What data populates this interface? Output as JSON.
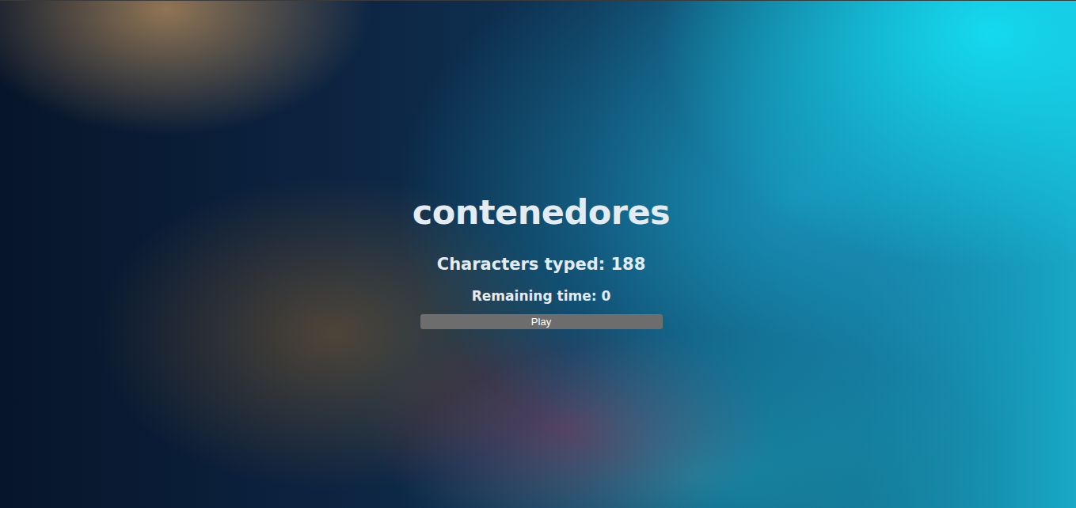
{
  "game": {
    "word": "contenedores",
    "characters_typed": "Characters typed: 188",
    "remaining_time": "Remaining time: 0",
    "play_button": {
      "label": "Play",
      "disabled": false
    }
  }
}
